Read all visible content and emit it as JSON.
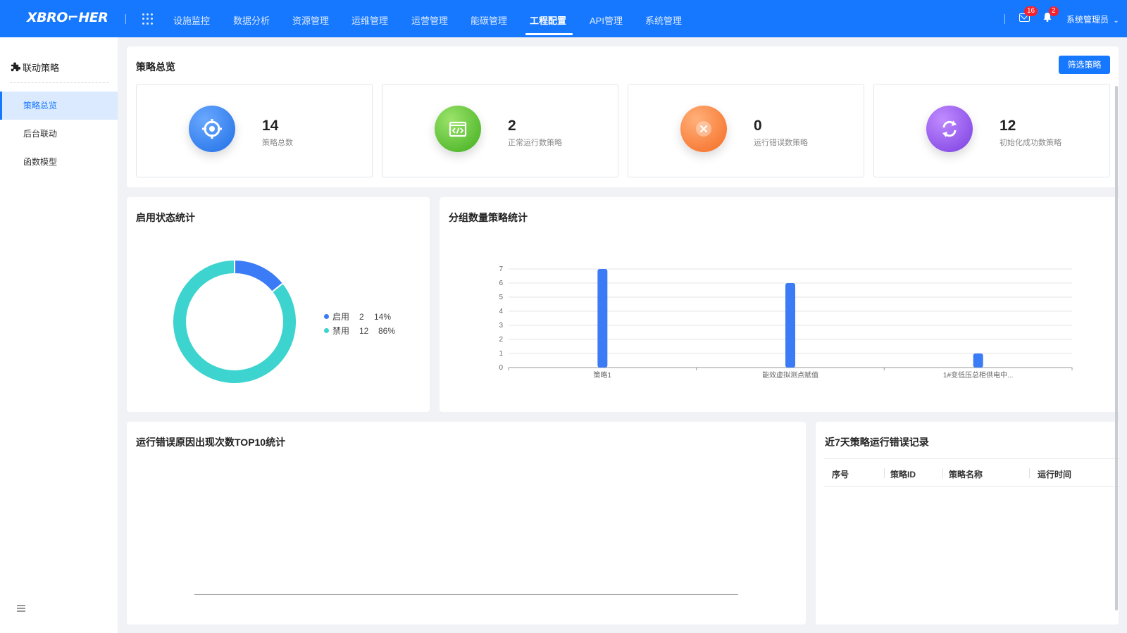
{
  "app": {
    "logo": "XBRO⌐HER"
  },
  "nav": {
    "items": [
      {
        "label": "设施监控"
      },
      {
        "label": "数据分析"
      },
      {
        "label": "资源管理"
      },
      {
        "label": "运维管理"
      },
      {
        "label": "运营管理"
      },
      {
        "label": "能碳管理"
      },
      {
        "label": "工程配置"
      },
      {
        "label": "API管理"
      },
      {
        "label": "系统管理"
      }
    ],
    "active_index": 6
  },
  "header": {
    "mail_count": "16",
    "bell_count": "2",
    "user": "系统管理员"
  },
  "sidebar": {
    "title": "联动策略",
    "items": [
      {
        "label": "策略总览"
      },
      {
        "label": "后台联动"
      },
      {
        "label": "函数模型"
      }
    ],
    "active_index": 0
  },
  "overview": {
    "title": "策略总览",
    "filter_button": "筛选策略",
    "cards": [
      {
        "value": "14",
        "label": "策略总数",
        "icon": "target-icon",
        "color": "#2f80ed"
      },
      {
        "value": "2",
        "label": "正常运行数策略",
        "icon": "code-window-icon",
        "color": "#52c41a"
      },
      {
        "value": "0",
        "label": "运行错误数策略",
        "icon": "close-circle-icon",
        "color": "#fa7a35"
      },
      {
        "value": "12",
        "label": "初始化成功数策略",
        "icon": "refresh-icon",
        "color": "#9254de"
      }
    ]
  },
  "status_panel": {
    "title": "启用状态统计"
  },
  "group_panel": {
    "title": "分组数量策略统计"
  },
  "error_top_panel": {
    "title": "运行错误原因出现次数TOP10统计"
  },
  "error_log_panel": {
    "title": "近7天策略运行错误记录",
    "columns": [
      "序号",
      "策略ID",
      "策略名称",
      "运行时间"
    ]
  },
  "chart_data": [
    {
      "type": "pie",
      "style": "donut",
      "slices": [
        {
          "name": "启用",
          "value": 2,
          "percent": "14%",
          "color": "#3b7cf6"
        },
        {
          "name": "禁用",
          "value": 12,
          "percent": "86%",
          "color": "#3dd4cf"
        }
      ],
      "legend": "right"
    },
    {
      "type": "bar",
      "categories": [
        "策略1",
        "能效虚拟测点赋值",
        "1#变低压总柜供电中..."
      ],
      "values": [
        7,
        6,
        1
      ],
      "ylim": [
        0,
        7
      ],
      "yticks": [
        "0",
        "1",
        "2",
        "3",
        "4",
        "5",
        "6",
        "7"
      ],
      "color": "#3b7cf6",
      "grid": true
    }
  ]
}
